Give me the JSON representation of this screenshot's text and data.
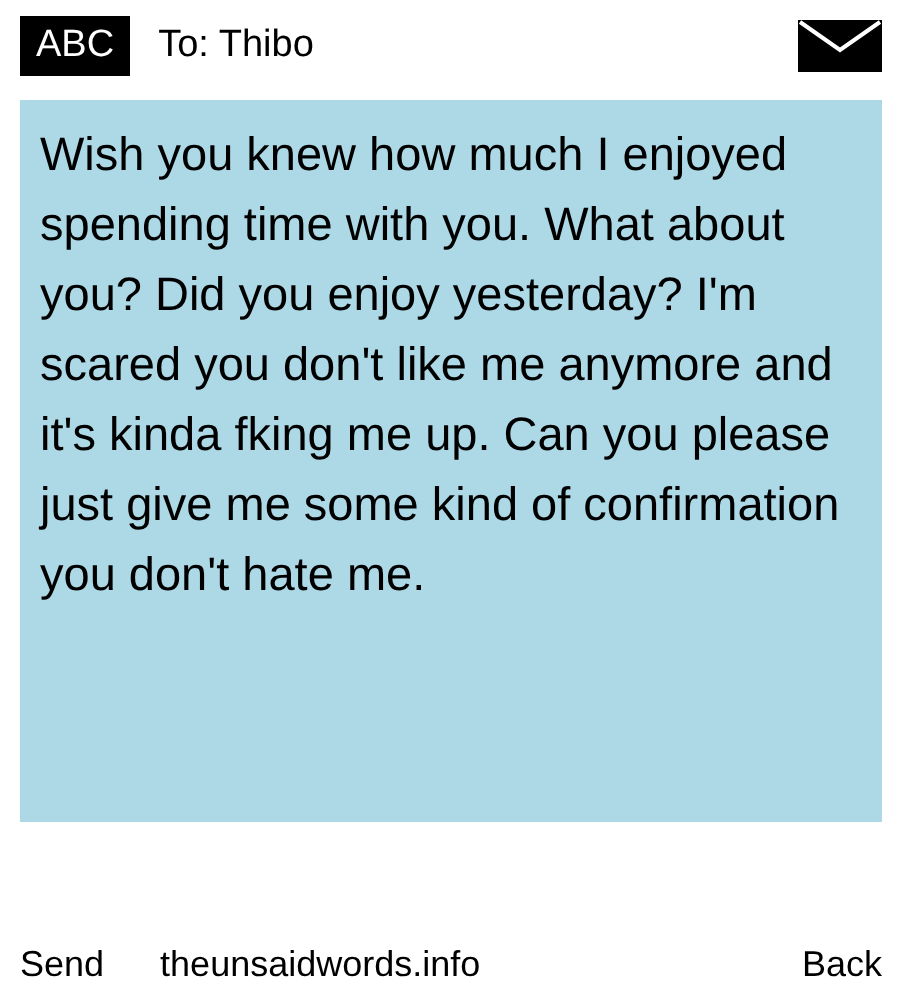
{
  "header": {
    "mode": "ABC",
    "recipient": "To: Thibo"
  },
  "message": {
    "text": "Wish you knew how much I enjoyed spending time with you. What about you? Did you enjoy yesterday? I'm scared you don't like me anymore and it's kinda fking me up. Can you please just give me some kind of confirmation you don't hate me."
  },
  "softkeys": {
    "left": "Send",
    "center": "theunsaidwords.info",
    "right": "Back"
  }
}
